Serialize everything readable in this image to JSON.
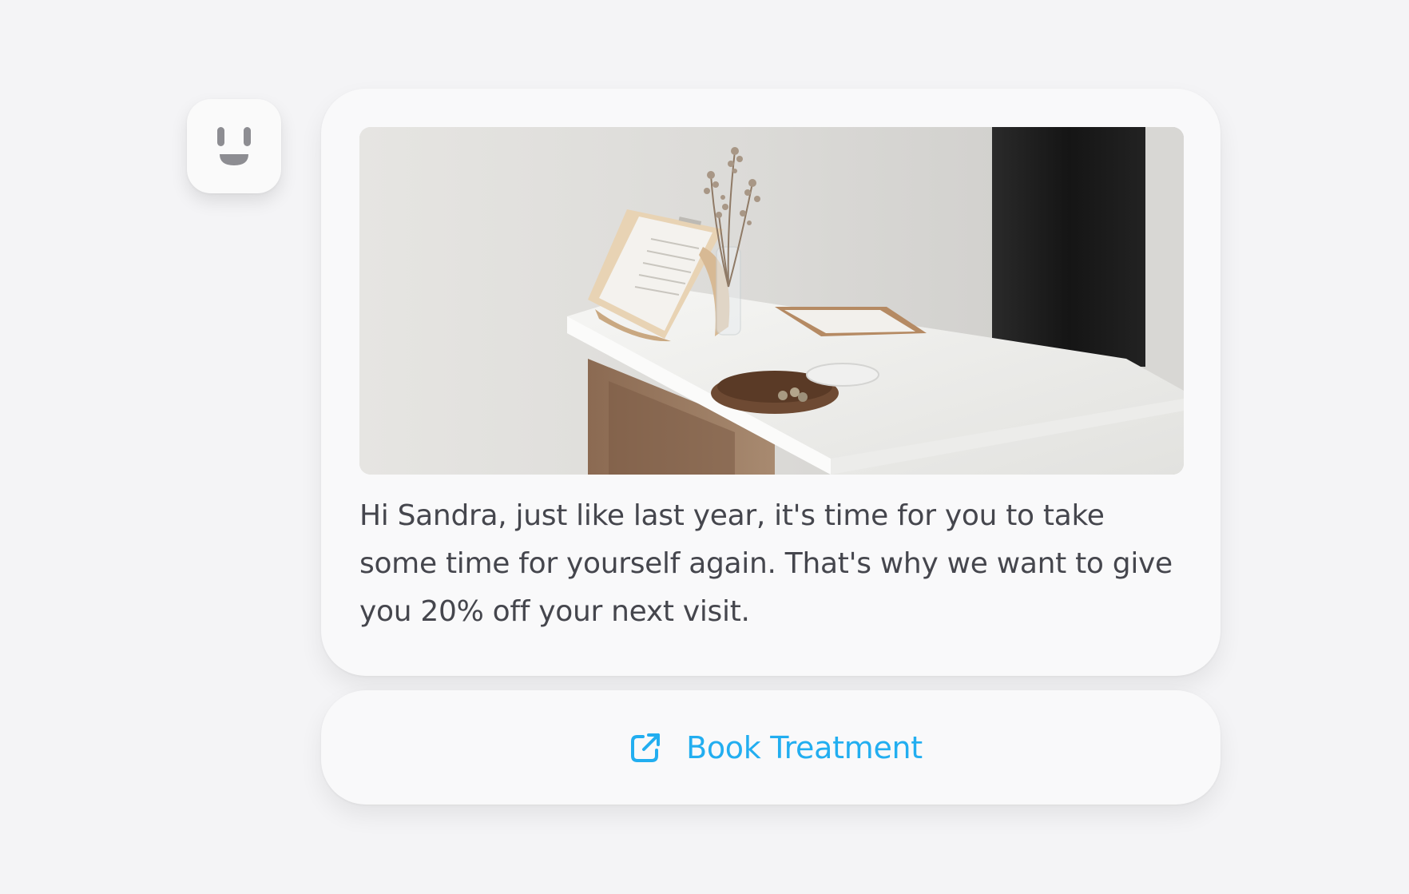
{
  "avatar": {
    "icon": "smiley-face-icon"
  },
  "message": {
    "image_icon": "reception-desk-photo",
    "text": "Hi Sandra, just like last year, it's time for you to take some time for yourself again. That's why we want to give you 20% off your next visit."
  },
  "action": {
    "label": "Book Treatment",
    "icon": "external-link-icon",
    "color": "#22aef0"
  },
  "colors": {
    "background": "#f4f4f6",
    "card": "#f9f9fa",
    "text": "#45464d",
    "accent": "#22aef0"
  }
}
